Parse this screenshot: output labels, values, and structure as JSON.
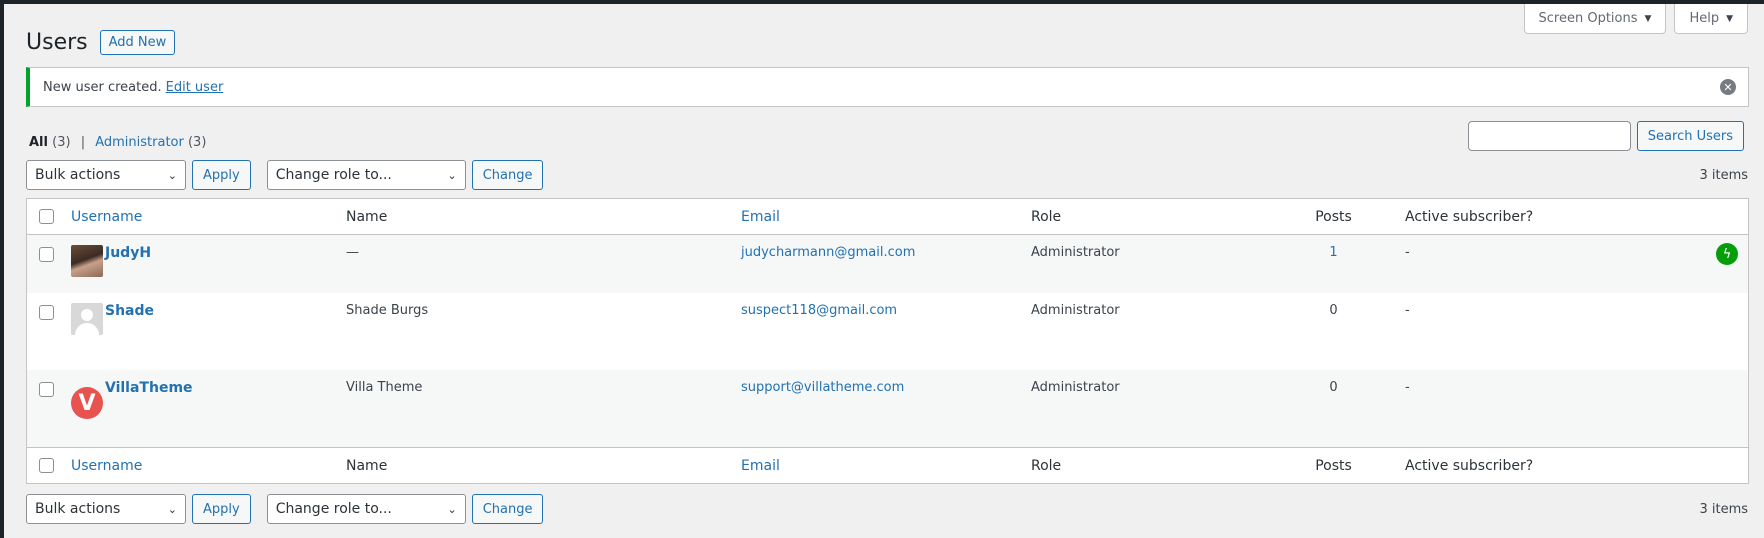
{
  "screen_meta": {
    "screen_options": "Screen Options",
    "help": "Help"
  },
  "header": {
    "title": "Users",
    "add_new": "Add New"
  },
  "notice": {
    "text": "New user created.",
    "link": "Edit user"
  },
  "filters": {
    "all_label": "All",
    "all_count": "(3)",
    "admin_label": "Administrator",
    "admin_count": "(3)"
  },
  "search": {
    "button": "Search Users",
    "value": ""
  },
  "tablenav": {
    "bulk_actions": "Bulk actions",
    "apply": "Apply",
    "change_role": "Change role to...",
    "change": "Change",
    "items": "3 items"
  },
  "columns": {
    "username": "Username",
    "name": "Name",
    "email": "Email",
    "role": "Role",
    "posts": "Posts",
    "active": "Active subscriber?"
  },
  "users": [
    {
      "username": "JudyH",
      "name": "—",
      "email": "judycharmann@gmail.com",
      "role": "Administrator",
      "posts": "1",
      "active": "-",
      "avatar": "photo",
      "badge_icon": "jetpack-bolt-icon"
    },
    {
      "username": "Shade",
      "name": "Shade Burgs",
      "email": "suspect118@gmail.com",
      "role": "Administrator",
      "posts": "0",
      "active": "-",
      "avatar": "default-person"
    },
    {
      "username": "VillaTheme",
      "name": "Villa Theme",
      "email": "support@villatheme.com",
      "role": "Administrator",
      "posts": "0",
      "active": "-",
      "avatar": "villa-logo",
      "avatar_letter": "V"
    }
  ],
  "colors": {
    "accent": "#2271b1",
    "success": "#00a32a",
    "jetpack": "#069e08",
    "villa": "#e8524f"
  }
}
